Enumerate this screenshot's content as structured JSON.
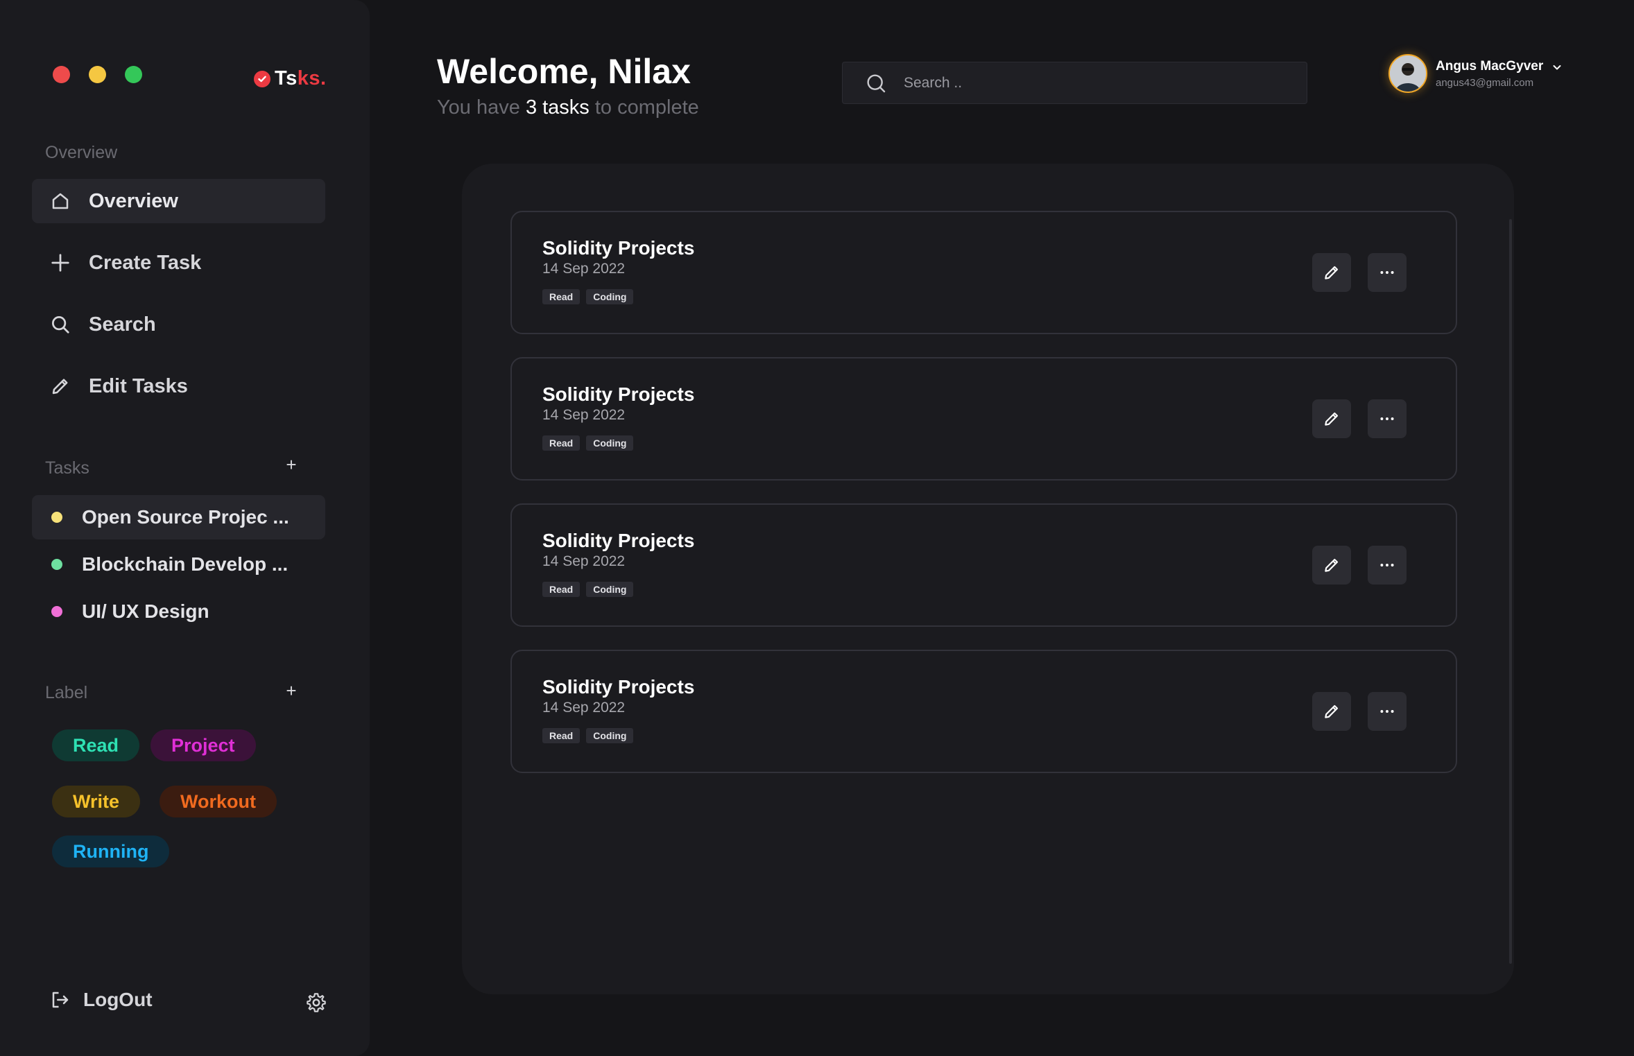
{
  "window": {
    "controls": [
      "close",
      "minimize",
      "maximize"
    ]
  },
  "logo": {
    "text_white": "T",
    "text_plain": "s",
    "text_red": "ks.",
    "check_icon": "check-circle-icon",
    "accent": "#ec3a42"
  },
  "sidebar": {
    "overview_title": "Overview",
    "nav": [
      {
        "label": "Overview",
        "icon": "home-icon",
        "active": true
      },
      {
        "label": "Create Task",
        "icon": "plus-icon",
        "active": false
      },
      {
        "label": "Search",
        "icon": "search-icon",
        "active": false
      },
      {
        "label": "Edit Tasks",
        "icon": "pencil-icon",
        "active": false
      }
    ],
    "tasks_title": "Tasks",
    "tasks_add": "+",
    "tasks": [
      {
        "label": "Open Source Projec ...",
        "color": "#f7e27a",
        "active": true
      },
      {
        "label": "Blockchain Develop ...",
        "color": "#6ee0a0",
        "active": false
      },
      {
        "label": "UI/ UX Design",
        "color": "#f06fd6",
        "active": false
      }
    ],
    "label_title": "Label",
    "label_add": "+",
    "labels": [
      {
        "label": "Read",
        "text_color": "#2ee0b3",
        "bg": "#0f3a33"
      },
      {
        "label": "Project",
        "text_color": "#e02fd6",
        "bg": "#3b1239"
      },
      {
        "label": "Write",
        "text_color": "#f5c12b",
        "bg": "#3b3012"
      },
      {
        "label": "Workout",
        "text_color": "#f06a1f",
        "bg": "#3b1c10"
      },
      {
        "label": "Running",
        "text_color": "#1fb3f5",
        "bg": "#0e2c3c"
      }
    ],
    "logout_label": "LogOut"
  },
  "header": {
    "welcome": "Welcome, Nilax",
    "subtitle_pre": "You have ",
    "subtitle_count": "3 tasks",
    "subtitle_post": " to complete",
    "search_placeholder": "Search .."
  },
  "user": {
    "name": "Angus MacGyver",
    "email": "angus43@gmail.com"
  },
  "cards": [
    {
      "title": "Solidity Projects",
      "date": "14 Sep 2022",
      "tags": [
        "Read",
        "Coding"
      ]
    },
    {
      "title": "Solidity Projects",
      "date": "14 Sep 2022",
      "tags": [
        "Read",
        "Coding"
      ]
    },
    {
      "title": "Solidity Projects",
      "date": "14 Sep 2022",
      "tags": [
        "Read",
        "Coding"
      ]
    },
    {
      "title": "Solidity Projects",
      "date": "14 Sep 2022",
      "tags": [
        "Read",
        "Coding"
      ]
    }
  ]
}
